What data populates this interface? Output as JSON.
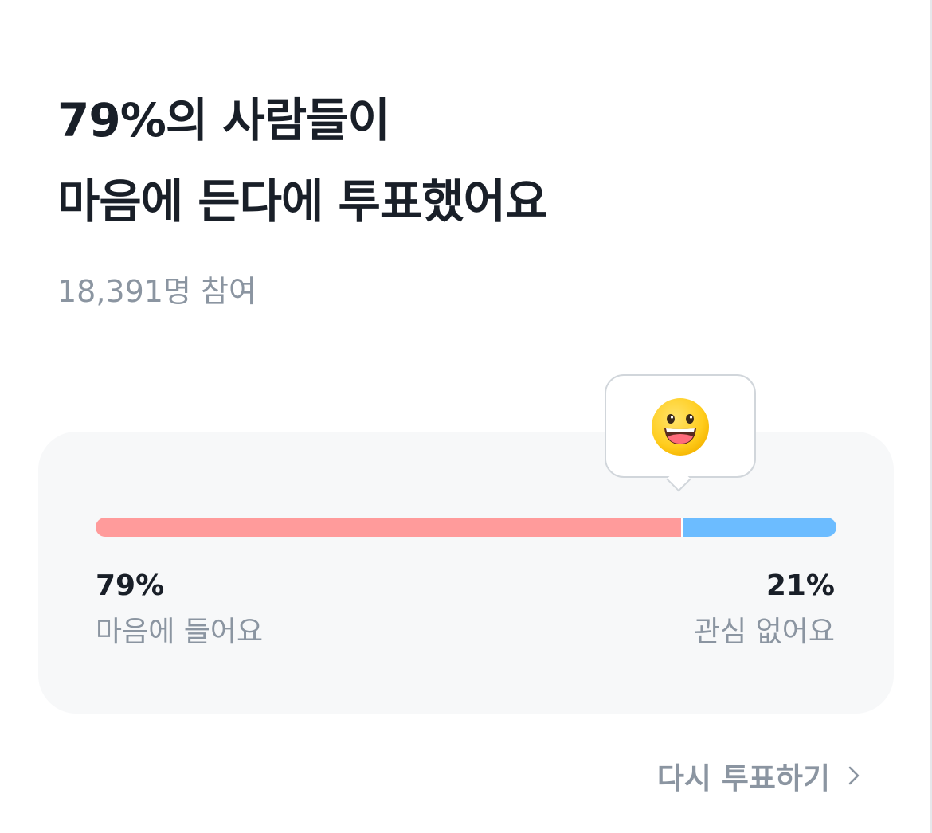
{
  "headline": {
    "line1": "79%의 사람들이",
    "line2": "마음에 든다에 투표했어요"
  },
  "participants": "18,391명 참여",
  "poll": {
    "left": {
      "percent_label": "79%",
      "label": "마음에 들어요",
      "value": 79,
      "color": "#ff9b9b"
    },
    "right": {
      "percent_label": "21%",
      "label": "관심 없어요",
      "value": 21,
      "color": "#6cbcff"
    },
    "indicator_icon": "grinning-face-icon"
  },
  "revote": {
    "label": "다시 투표하기",
    "icon": "chevron-right-icon"
  }
}
